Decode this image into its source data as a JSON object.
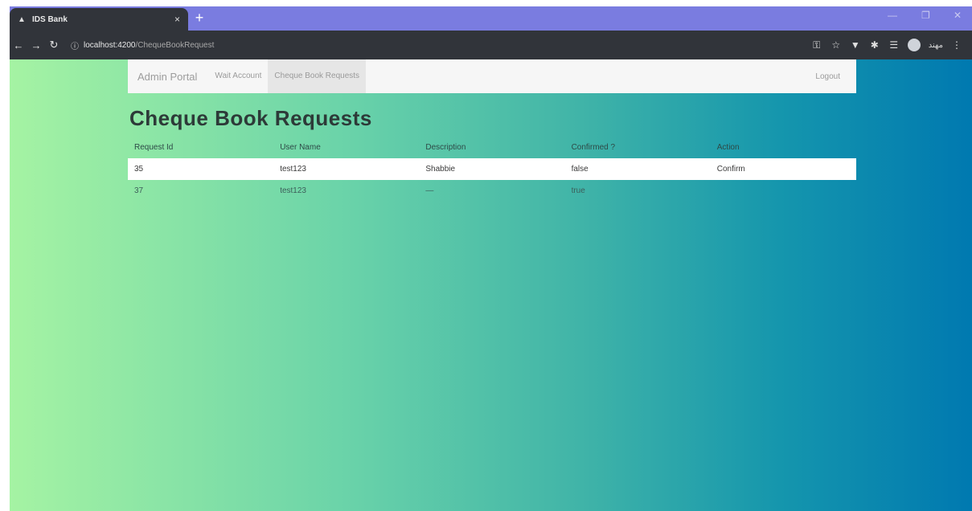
{
  "browser": {
    "tab_title": "IDS Bank",
    "tab_close": "×",
    "new_tab": "+",
    "url_host": "localhost:4200",
    "url_path": "/ChequeBookRequest",
    "window_controls": [
      "—",
      "❐",
      "✕"
    ],
    "profile_name": "مهند"
  },
  "nav": {
    "brand": "Admin Portal",
    "links": [
      "Wait Account",
      "Cheque Book Requests"
    ],
    "logout": "Logout"
  },
  "page": {
    "title": "Cheque Book Requests"
  },
  "table": {
    "headers": [
      "Request Id",
      "User Name",
      "Description",
      "Confirmed ?",
      "Action"
    ],
    "rows": [
      {
        "id": "35",
        "user": "test123",
        "description": "Shabbie",
        "confirmed": "false",
        "action": "Confirm"
      },
      {
        "id": "37",
        "user": "test123",
        "description": "—",
        "confirmed": "true",
        "action": ""
      }
    ]
  }
}
